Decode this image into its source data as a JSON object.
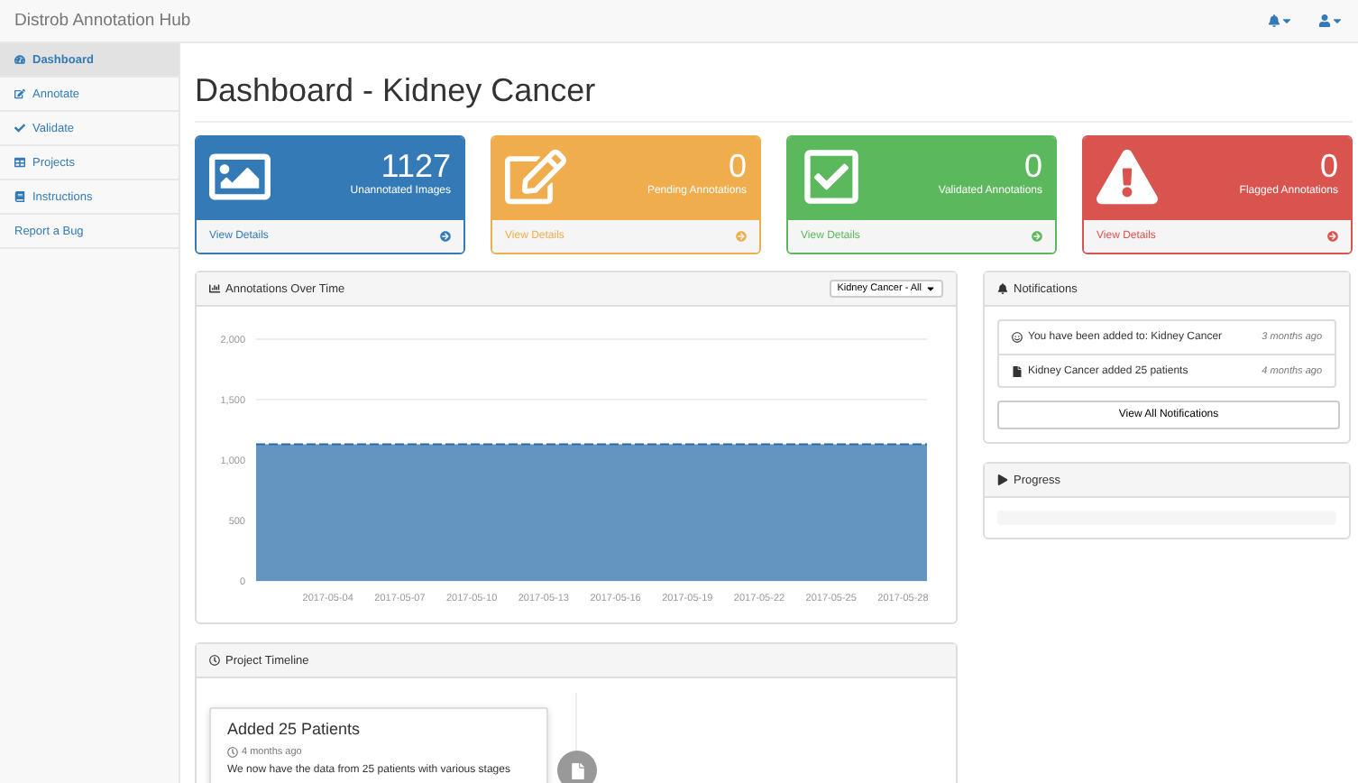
{
  "navbar": {
    "brand": "Distrob Annotation Hub"
  },
  "sidebar": {
    "items": [
      {
        "label": "Dashboard",
        "selected": true
      },
      {
        "label": "Annotate",
        "selected": false
      },
      {
        "label": "Validate",
        "selected": false
      },
      {
        "label": "Projects",
        "selected": false
      },
      {
        "label": "Instructions",
        "selected": false
      },
      {
        "label": "Report a Bug",
        "selected": false
      }
    ]
  },
  "page_title": "Dashboard - Kidney Cancer",
  "stat_cards": [
    {
      "kind": "image",
      "count": "1127",
      "label": "Unannotated Images",
      "link": "View Details",
      "color": "#337ab7"
    },
    {
      "kind": "edit",
      "count": "0",
      "label": "Pending Annotations",
      "link": "View Details",
      "color": "#f0ad4e"
    },
    {
      "kind": "check",
      "count": "0",
      "label": "Validated Annotations",
      "link": "View Details",
      "color": "#5cb85c"
    },
    {
      "kind": "warning",
      "count": "0",
      "label": "Flagged Annotations",
      "link": "View Details",
      "color": "#d9534f"
    }
  ],
  "chart_panel": {
    "title": "Annotations Over Time",
    "filter": "Kidney Cancer - All",
    "chart_data": {
      "type": "area",
      "x": [
        "2017-05-01",
        "2017-05-02",
        "2017-05-03",
        "2017-05-04",
        "2017-05-05",
        "2017-05-06",
        "2017-05-07",
        "2017-05-08",
        "2017-05-09",
        "2017-05-10",
        "2017-05-11",
        "2017-05-12",
        "2017-05-13",
        "2017-05-14",
        "2017-05-15",
        "2017-05-16",
        "2017-05-17",
        "2017-05-18",
        "2017-05-19",
        "2017-05-20",
        "2017-05-21",
        "2017-05-22",
        "2017-05-23",
        "2017-05-24",
        "2017-05-25",
        "2017-05-26",
        "2017-05-27",
        "2017-05-28",
        "2017-05-29"
      ],
      "series": [
        {
          "color": "#6495c0",
          "values": [
            1130,
            1130,
            1130,
            1130,
            1130,
            1130,
            1130,
            1130,
            1130,
            1130,
            1130,
            1130,
            1130,
            1130,
            1130,
            1130,
            1130,
            1130,
            1130,
            1130,
            1130,
            1130,
            1130,
            1130,
            1130,
            1130,
            1130,
            1130,
            1130
          ]
        }
      ],
      "xlim": [
        "2017-05-01",
        "2017-05-29"
      ],
      "ylim": [
        0,
        2000
      ],
      "yticks": [
        {
          "value": 0,
          "label": "0"
        },
        {
          "value": 500,
          "label": "500"
        },
        {
          "value": 1000,
          "label": "1,000"
        },
        {
          "value": 1500,
          "label": "1,500"
        },
        {
          "value": 2000,
          "label": "2,000"
        }
      ],
      "xticks": [
        "2017-05-04",
        "2017-05-07",
        "2017-05-10",
        "2017-05-13",
        "2017-05-16",
        "2017-05-19",
        "2017-05-22",
        "2017-05-25",
        "2017-05-28"
      ]
    }
  },
  "notifications": {
    "title": "Notifications",
    "items": [
      {
        "text": "You have been added to: Kidney Cancer",
        "time": "3 months ago"
      },
      {
        "text": "Kidney Cancer added 25 patients",
        "time": "4 months ago"
      }
    ],
    "button": "View All Notifications"
  },
  "progress": {
    "title": "Progress"
  },
  "timeline": {
    "title": "Project Timeline",
    "entries": [
      {
        "title": "Added 25 Patients",
        "time": "4 months ago",
        "text": "We now have the data from 25 patients with various stages"
      }
    ]
  }
}
